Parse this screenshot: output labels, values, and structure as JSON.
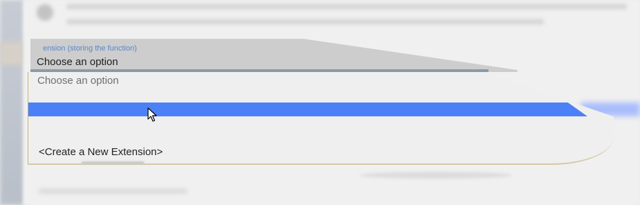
{
  "window": {
    "blurred_background": true
  },
  "extension_field": {
    "label": "Extension (storing the function)",
    "label_visible_text": "ension (storing the function)",
    "selected_value": "Choose an option",
    "options": [
      {
        "label": "Choose an option",
        "placeholder": true
      },
      {
        "label": "",
        "highlighted": true
      },
      {
        "label": "<Create a New Extension>"
      }
    ]
  },
  "colors": {
    "accent": "#4c80f7",
    "label_blue": "#5a86c8",
    "select_background": "#cdcdcd",
    "panel_background": "#efefef"
  },
  "icons": {
    "cursor": "mouse-pointer-icon"
  }
}
